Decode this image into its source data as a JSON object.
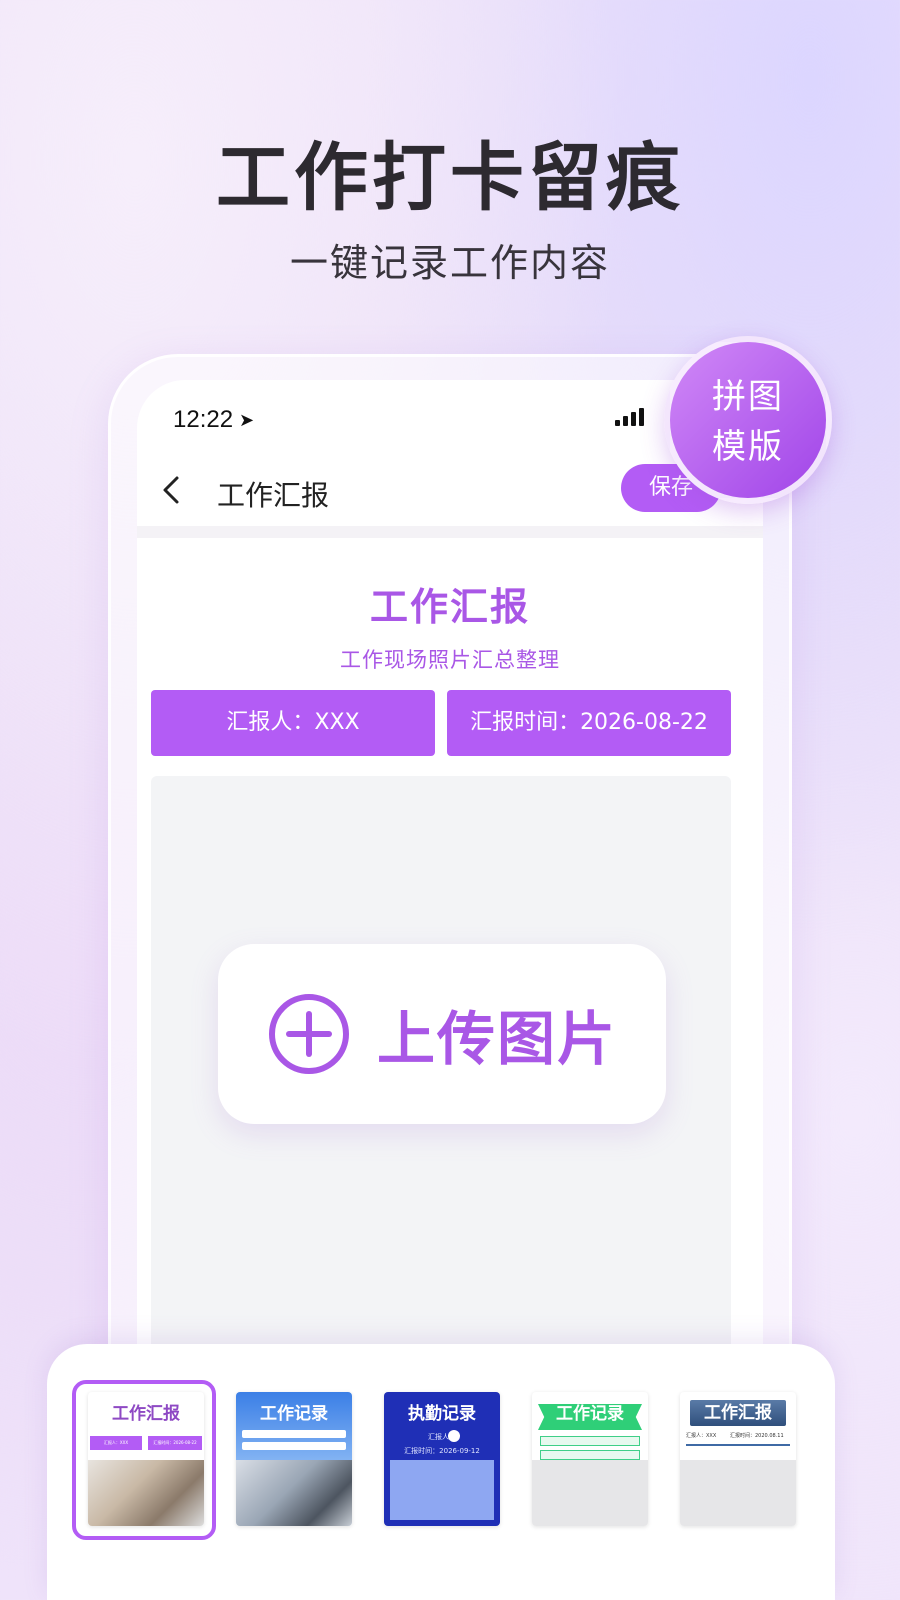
{
  "hero": {
    "title": "工作打卡留痕",
    "subtitle": "一键记录工作内容"
  },
  "badge": {
    "line1": "拼图",
    "line2": "模版"
  },
  "status_bar": {
    "time": "12:22"
  },
  "nav": {
    "title": "工作汇报",
    "save_label": "保存"
  },
  "report": {
    "title": "工作汇报",
    "subtitle": "工作现场照片汇总整理",
    "reporter": "汇报人：XXX",
    "report_time": "汇报时间：2026-08-22"
  },
  "upload": {
    "label": "上传图片"
  },
  "templates": [
    {
      "title": "工作汇报",
      "reporter": "汇报人：XXX",
      "time": "汇报时间：2026-08-22",
      "selected": true
    },
    {
      "title": "工作记录",
      "selected": false
    },
    {
      "title": "执勤记录",
      "reporter": "汇报人：",
      "time": "汇报时间：2026-09-12",
      "selected": false
    },
    {
      "title": "工作记录",
      "selected": false
    },
    {
      "title": "工作汇报",
      "reporter": "汇报人：XXX",
      "time": "汇报时间：2020.08.11",
      "selected": false
    }
  ],
  "colors": {
    "accent": "#b35cf5",
    "accent_text": "#a957e6",
    "hero_text": "#2d2a30"
  }
}
